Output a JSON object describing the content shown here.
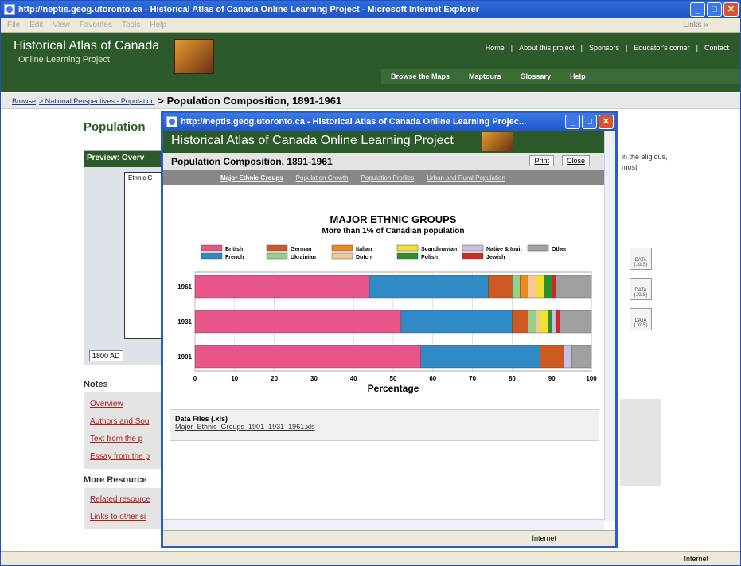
{
  "window": {
    "title": "http://neptis.geog.utoronto.ca - Historical Atlas of Canada Online Learning Project - Microsoft Internet Explorer"
  },
  "menu": [
    "File",
    "Edit",
    "View",
    "Favorites",
    "Tools",
    "Help"
  ],
  "menu_links": "Links »",
  "site": {
    "title": "Historical Atlas of Canada",
    "subtitle": "Online Learning Project",
    "topnav": [
      "Home",
      "|",
      "About this project",
      "|",
      "Sponsors",
      "|",
      "Educator's corner",
      "|",
      "Contact"
    ],
    "secnav": [
      "Browse the Maps",
      "Maptours",
      "Glossary",
      "Help"
    ]
  },
  "breadcrumb": {
    "items": [
      "Browse",
      "> National Perspectives - Population"
    ],
    "current": "> Population Composition, 1891-1961"
  },
  "page": {
    "title": "Population",
    "preview_label": "Preview: Overv",
    "map_label": "Ethnic C",
    "year": "1800 AD",
    "right_text": "in the eligious, most",
    "notes_heading": "Notes",
    "notes": [
      "Overview",
      "Authors and Sou",
      "Text from the p",
      "Essay from the p"
    ],
    "resources_heading": "More Resource",
    "resources": [
      "Related resource",
      "Links to other si"
    ],
    "data_icon": "DATA (.XLS)"
  },
  "status": {
    "zone": "Internet"
  },
  "popup": {
    "title": "http://neptis.geog.utoronto.ca - Historical Atlas of Canada Online Learning Projec...",
    "header": "Historical Atlas of Canada Online Learning Project",
    "section": "Population Composition, 1891-1961",
    "print": "Print",
    "close": "Close",
    "tabs": [
      "Major Ethnic Groups",
      "Population Growth",
      "Population Profiles",
      "Urban and Rural Population"
    ],
    "datafiles_heading": "Data Files (.xls)",
    "datafile": "Major_Ethnic_Groups_1901_1931_1961.xls",
    "zone": "Internet"
  },
  "chart_data": {
    "type": "bar",
    "title": "MAJOR ETHNIC GROUPS",
    "subtitle": "More than 1% of Canadian population",
    "xlabel": "Percentage",
    "xlim": [
      0,
      100
    ],
    "xticks": [
      0,
      10,
      20,
      30,
      40,
      50,
      60,
      70,
      80,
      90,
      100
    ],
    "categories": [
      "1961",
      "1931",
      "1901"
    ],
    "series": [
      {
        "name": "British",
        "color": "#e8558a",
        "values": [
          44,
          52,
          57
        ]
      },
      {
        "name": "French",
        "color": "#2f8ac6",
        "values": [
          30,
          28,
          30
        ]
      },
      {
        "name": "German",
        "color": "#cc5a22",
        "values": [
          6,
          4,
          6
        ]
      },
      {
        "name": "Ukrainian",
        "color": "#98d08a",
        "values": [
          2,
          2,
          0
        ]
      },
      {
        "name": "Italian",
        "color": "#e88a1e",
        "values": [
          2,
          0,
          0
        ]
      },
      {
        "name": "Dutch",
        "color": "#f5c89a",
        "values": [
          2,
          1,
          0
        ]
      },
      {
        "name": "Scandinavian",
        "color": "#f0e030",
        "values": [
          2,
          2,
          0
        ]
      },
      {
        "name": "Polish",
        "color": "#2e8f30",
        "values": [
          2,
          1,
          0
        ]
      },
      {
        "name": "Native & Inuit",
        "color": "#c8c0e0",
        "values": [
          0,
          1,
          2
        ]
      },
      {
        "name": "Jewish",
        "color": "#d02828",
        "values": [
          1,
          1,
          0
        ]
      },
      {
        "name": "Other",
        "color": "#a0a0a0",
        "values": [
          9,
          8,
          5
        ]
      }
    ]
  }
}
